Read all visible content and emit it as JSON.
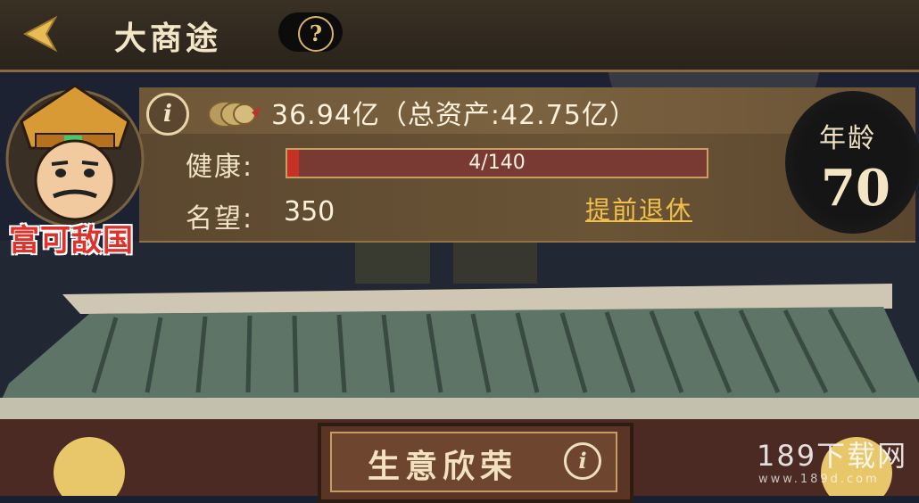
{
  "header": {
    "title": "大商途",
    "back_icon": "back-arrow-icon",
    "help_label": "?"
  },
  "profile": {
    "info_label": "i",
    "money": "36.94亿（总资产:42.75亿）",
    "money_icon": "coin-string-icon",
    "health_label": "健康:",
    "health_text": "4/140",
    "health_value": 4,
    "health_max": 140,
    "fame_label": "名望:",
    "fame_value": "350",
    "retire_label": "提前退休",
    "avatar_title": "富可敌国"
  },
  "age": {
    "label": "年龄",
    "value": "70"
  },
  "shop": {
    "sign_text": "生意欣荣",
    "sign_info": "i"
  },
  "watermark": {
    "main": "189下载网",
    "sub": "www.189d.com"
  },
  "colors": {
    "health_fill": "#c53224",
    "retire_link": "#f2bf4a",
    "avatar_title": "#e0322a"
  }
}
